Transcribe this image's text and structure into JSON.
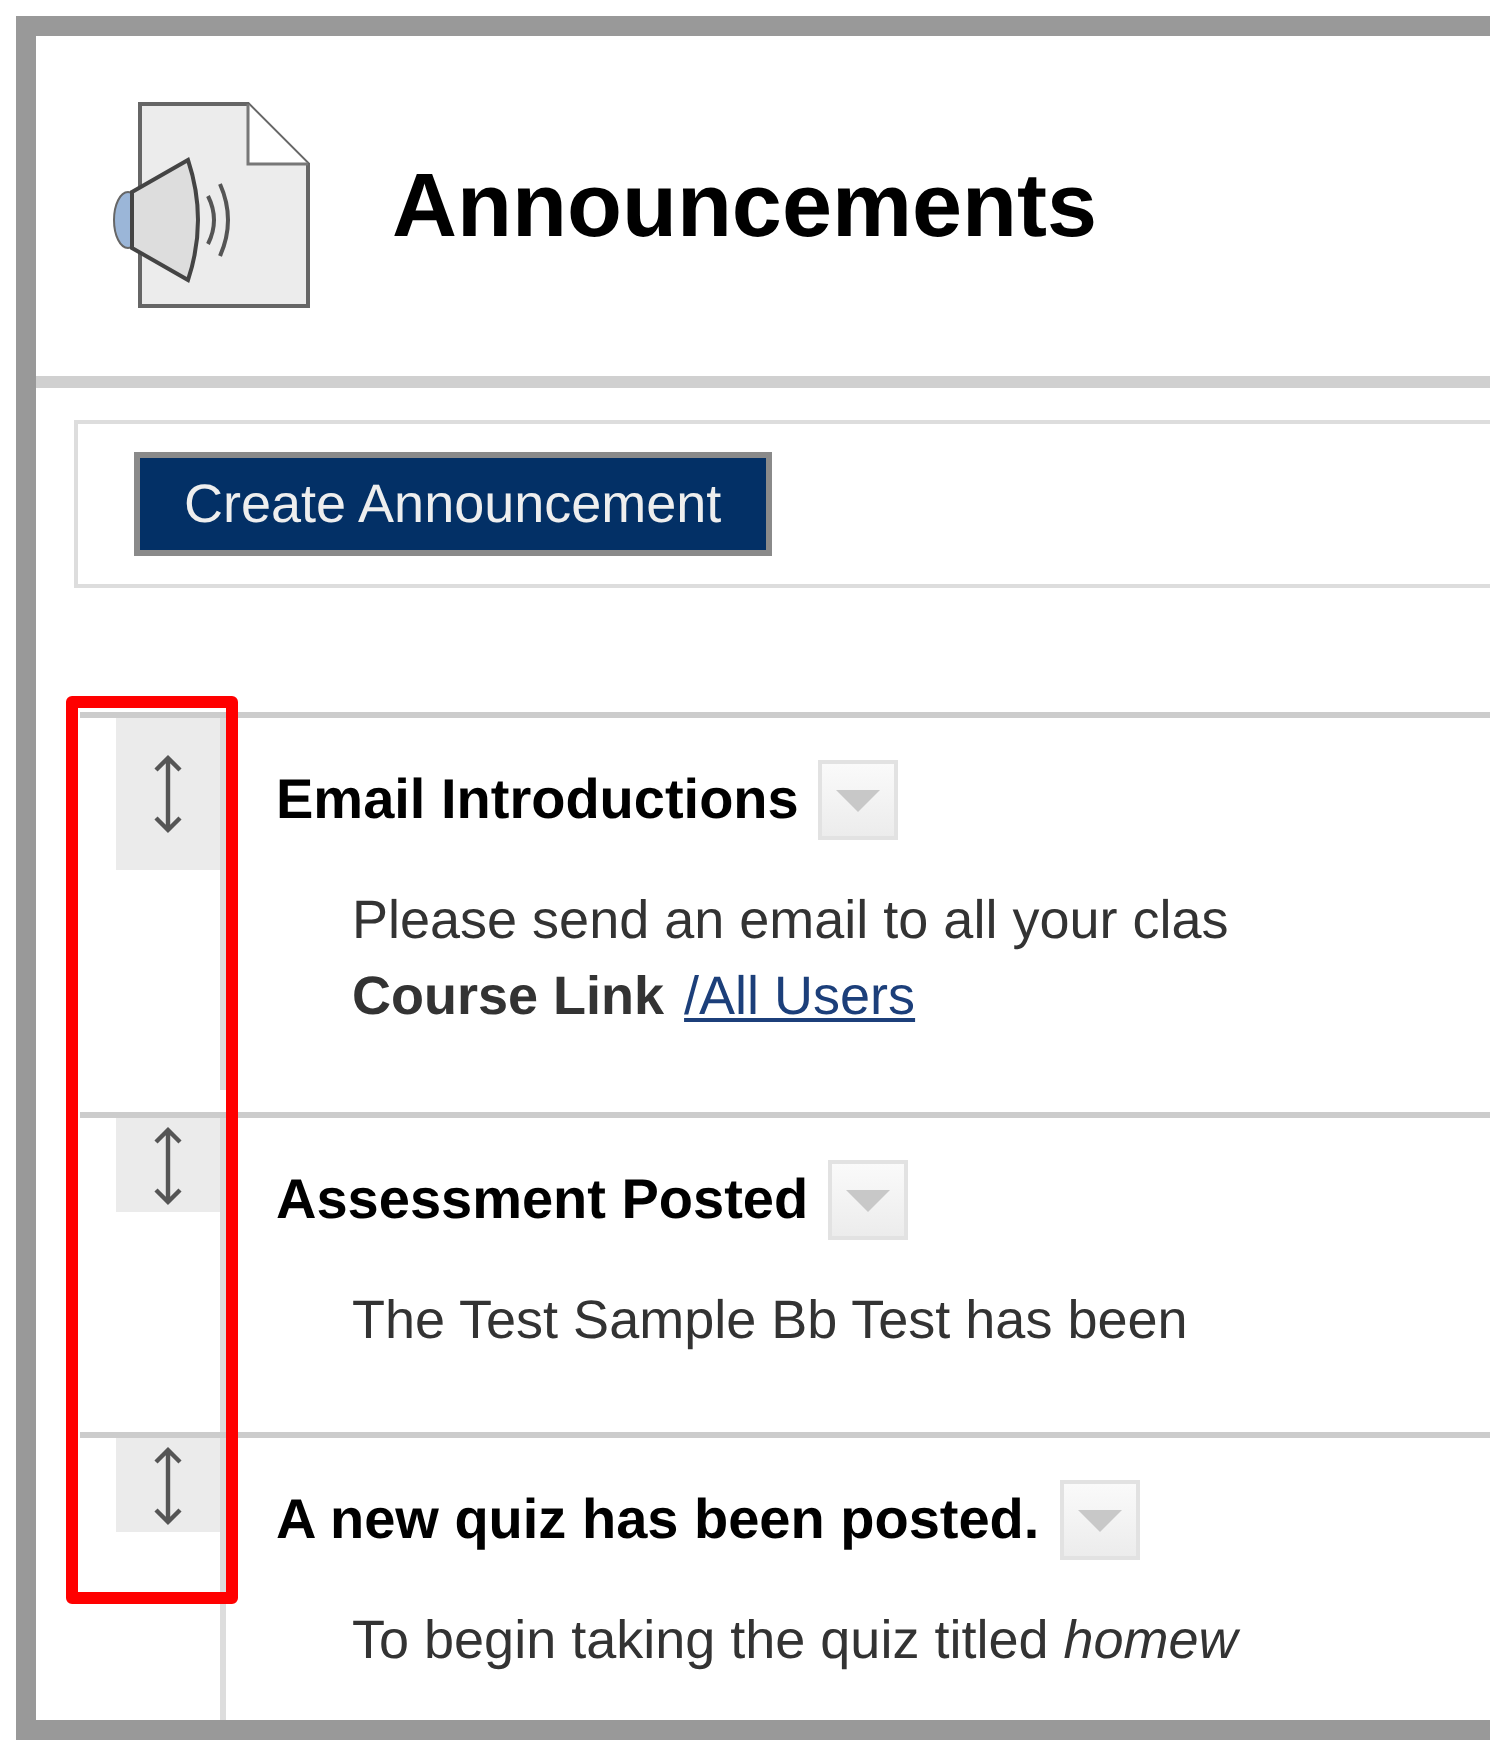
{
  "page": {
    "title": "Announcements"
  },
  "toolbar": {
    "buttons": [
      "Create Announcement"
    ]
  },
  "announcements": [
    {
      "title": "Email Introductions",
      "body": "Please send an email to all your clas",
      "meta_label": "Course Link",
      "meta_link": "/All Users"
    },
    {
      "title": "Assessment Posted",
      "body": "The Test Sample Bb Test has been"
    },
    {
      "title": "A new quiz has been posted.",
      "body": "To begin taking the quiz titled *homew*"
    }
  ]
}
